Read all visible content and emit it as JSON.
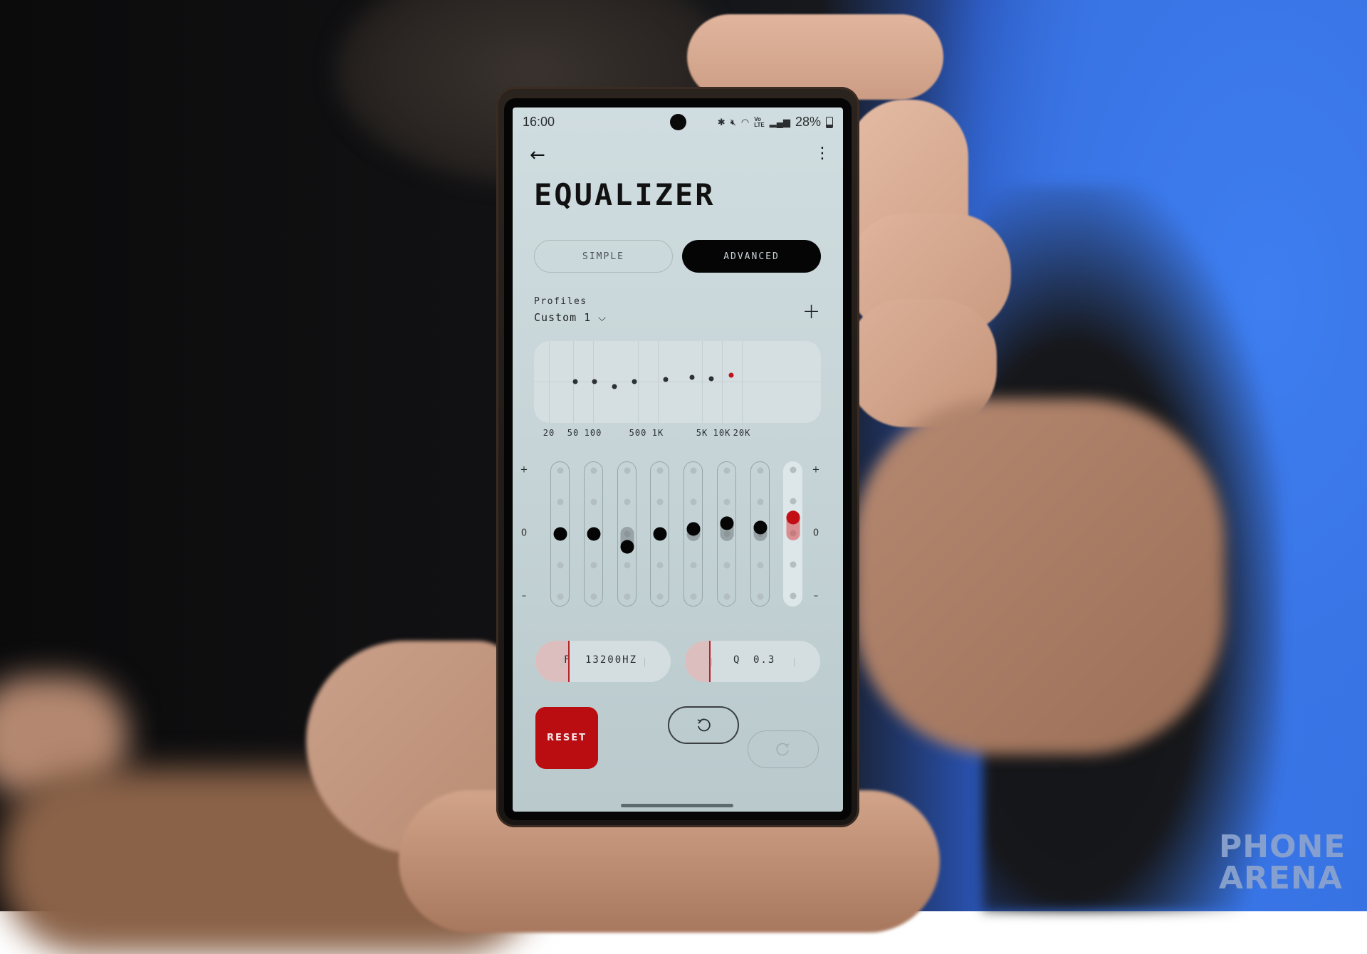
{
  "status_bar": {
    "time": "16:00",
    "icons": [
      "bluetooth-icon",
      "vibrate-mute-icon",
      "wifi-6-icon",
      "volte-icon",
      "signal-icon"
    ],
    "battery_text": "28%",
    "battery_percent": 28
  },
  "header": {
    "back_icon": "arrow-left",
    "menu_icon": "kebab-menu",
    "title": "EQUALIZER"
  },
  "mode_tabs": [
    {
      "label": "SIMPLE",
      "selected": false
    },
    {
      "label": "ADVANCED",
      "selected": true
    }
  ],
  "profiles": {
    "label": "Profiles",
    "selected": "Custom 1",
    "dropdown_icon": "chevron-down",
    "add_icon": "plus"
  },
  "graph": {
    "freq_labels": [
      "20",
      "50",
      "100",
      "500",
      "1K",
      "5K",
      "10K",
      "20K"
    ],
    "selected_band": 7
  },
  "bands": {
    "scale_labels": {
      "top": "+",
      "zero": "0",
      "bottom": "–"
    },
    "levels_in_steps": [
      0,
      0,
      -0.4,
      0,
      0.15,
      0.35,
      0.2,
      0.5
    ],
    "selected_index": 7,
    "accent_color": "#c20f16"
  },
  "parameters": {
    "frequency": {
      "prefix": "F",
      "value": "13200HZ",
      "fill_fraction": 0.24
    },
    "q": {
      "prefix": "Q",
      "value": "0.3",
      "fill_fraction": 0.18
    }
  },
  "actions": {
    "reset_label": "RESET",
    "undo_icon": "undo",
    "redo_icon": "redo",
    "redo_enabled": false
  },
  "watermark": {
    "line1": "PHONE",
    "line2": "ARENA"
  }
}
